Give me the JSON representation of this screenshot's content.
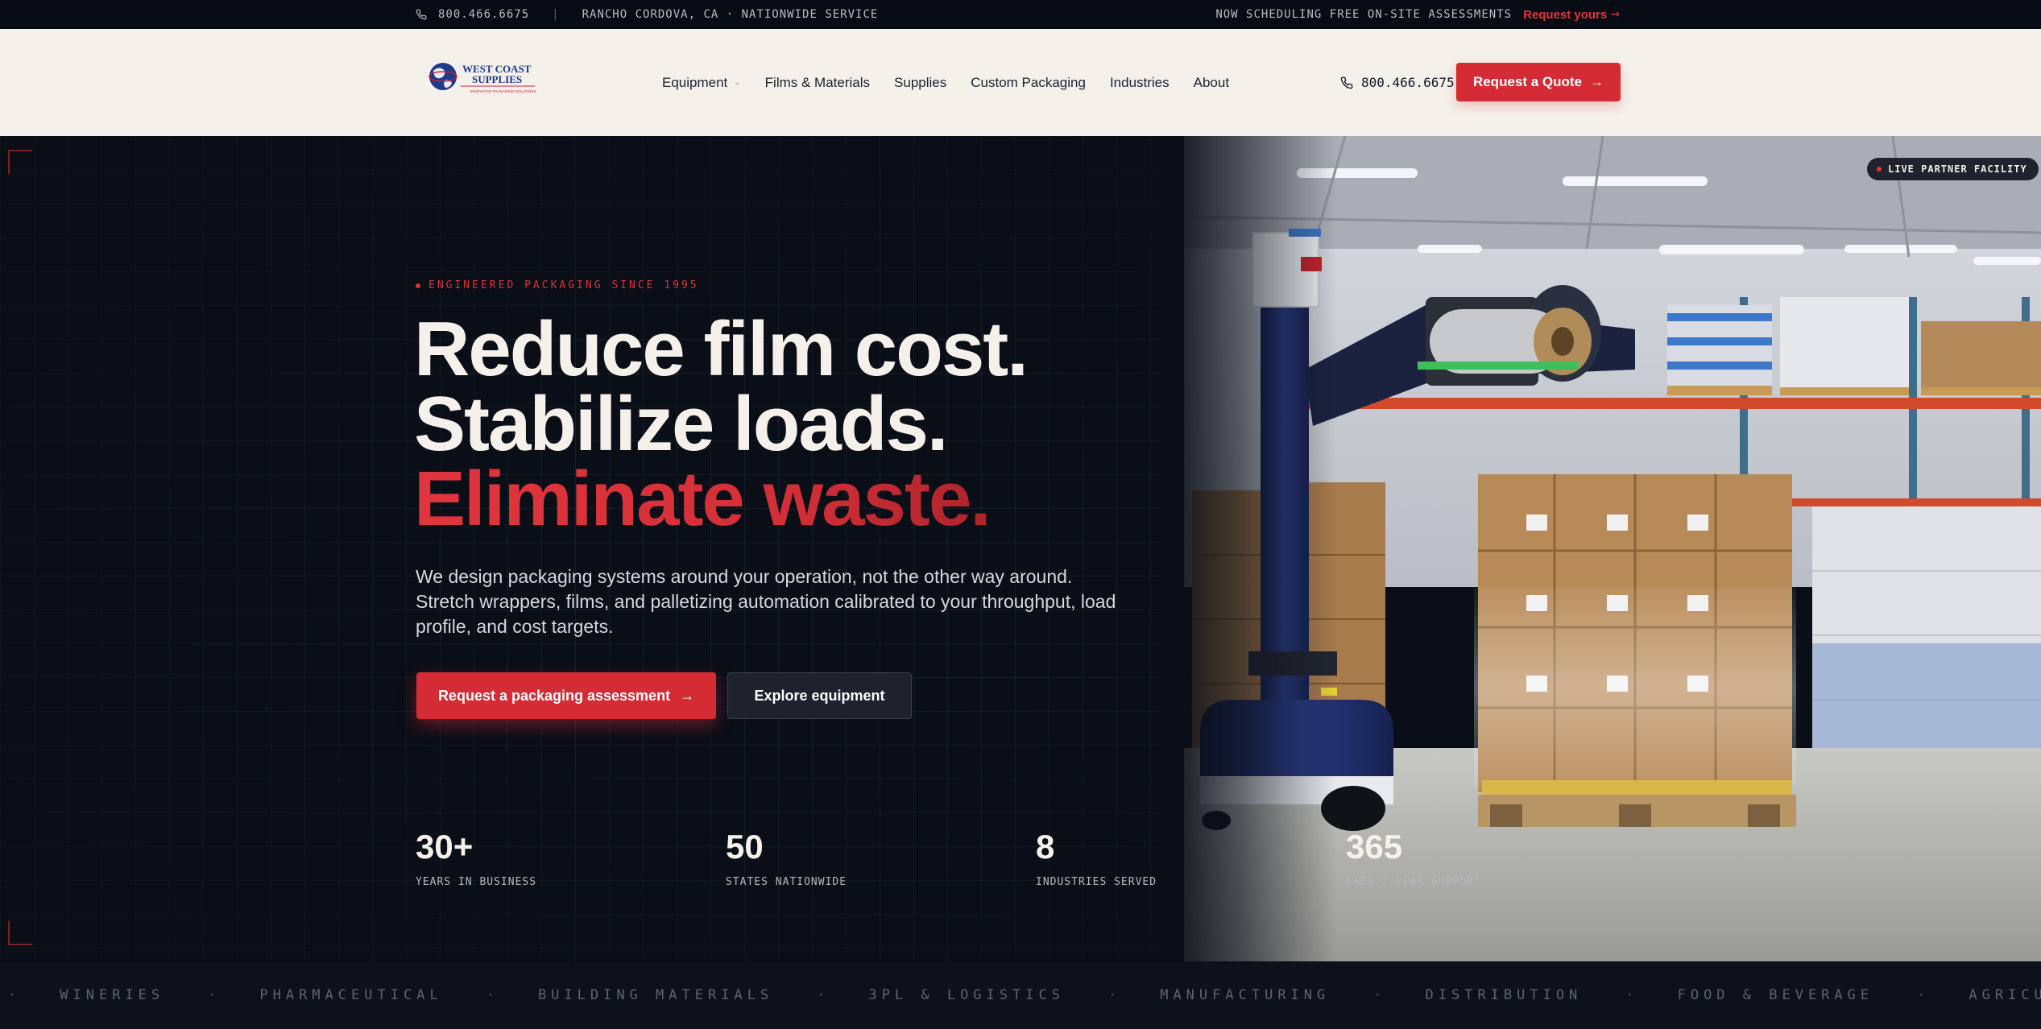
{
  "topbar": {
    "phone": "800.466.6675",
    "location": "RANCHO CORDOVA, CA · NATIONWIDE SERVICE",
    "separator": "|",
    "scheduling": "NOW SCHEDULING FREE ON-SITE ASSESSMENTS",
    "cta": "Request yours",
    "cta_arrow": "→"
  },
  "header": {
    "logo_text_line1": "WEST COAST",
    "logo_text_line2": "SUPPLIES",
    "logo_tagline": "INNOVATIVE PACKAGING SOLUTIONS",
    "nav": [
      {
        "label": "Equipment",
        "has_dropdown": true
      },
      {
        "label": "Films & Materials"
      },
      {
        "label": "Supplies"
      },
      {
        "label": "Custom Packaging"
      },
      {
        "label": "Industries"
      },
      {
        "label": "About"
      }
    ],
    "dropdown_chevron": "⌄",
    "phone": "800.466.6675",
    "quote_button": "Request a Quote",
    "quote_arrow": "→"
  },
  "hero": {
    "badge": "LIVE PARTNER FACILITY",
    "eyebrow": "ENGINEERED PACKAGING SINCE 1995",
    "headline_line1": "Reduce film cost.",
    "headline_line2": "Stabilize loads.",
    "headline_line3": "Eliminate waste.",
    "lead": "We design packaging systems around your operation, not the other way around. Stretch wrappers, films, and palletizing automation calibrated to your throughput, load profile, and cost targets.",
    "primary_button": "Request a packaging assessment",
    "primary_arrow": "→",
    "secondary_button": "Explore equipment",
    "stats": [
      {
        "value": "30+",
        "label": "YEARS IN BUSINESS"
      },
      {
        "value": "50",
        "label": "STATES NATIONWIDE"
      },
      {
        "value": "8",
        "label": "INDUSTRIES SERVED"
      },
      {
        "value": "365",
        "label": "DAYS / YEAR SUPPORT"
      }
    ]
  },
  "ticker": {
    "separator": "·",
    "items": [
      "WINERIES",
      "PHARMACEUTICAL",
      "BUILDING MATERIALS",
      "3PL & LOGISTICS",
      "MANUFACTURING",
      "DISTRIBUTION",
      "FOOD & BEVERAGE",
      "AGRICULTURE"
    ]
  },
  "colors": {
    "brand_red": "#d42b34",
    "hero_bg": "#0a0e17",
    "header_bg": "#f4f1eb",
    "robot_blue": "#1f2f6b"
  }
}
